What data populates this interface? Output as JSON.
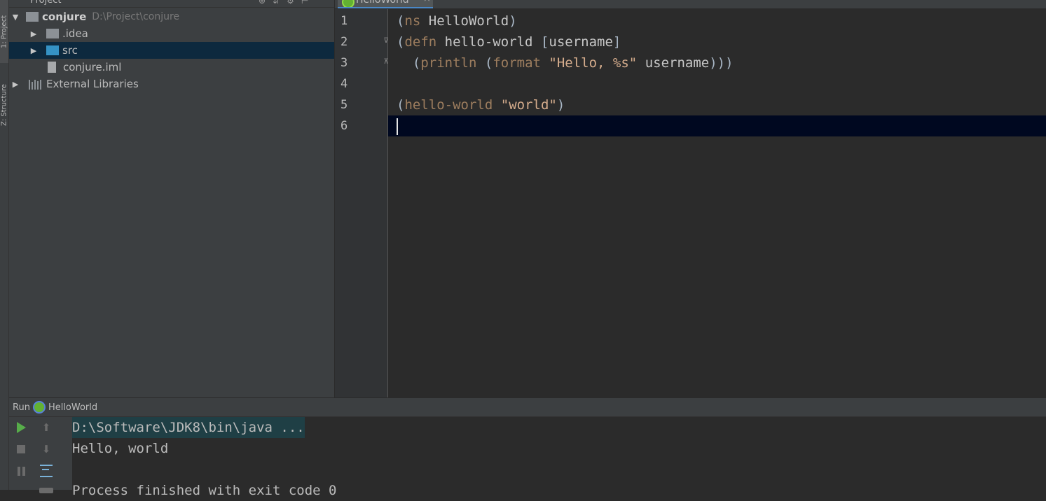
{
  "tool_strip": {
    "project_tab": "1: Project",
    "structure_tab": "Z: Structure"
  },
  "project_panel": {
    "title": "Project",
    "tree": [
      {
        "label": "conjure",
        "path": "D:\\Project\\conjure",
        "icon": "module-folder-icon",
        "expanded": true
      },
      {
        "label": ".idea",
        "icon": "folder-icon"
      },
      {
        "label": "src",
        "icon": "source-folder-icon",
        "selected": true
      },
      {
        "label": "conjure.iml",
        "icon": "file-icon"
      },
      {
        "label": "External Libraries",
        "icon": "library-icon"
      }
    ]
  },
  "editor": {
    "tab_label": "HelloWorld",
    "line_numbers": [
      "1",
      "2",
      "3",
      "4",
      "5",
      "6"
    ],
    "current_line": 6
  },
  "run_panel": {
    "label": "Run",
    "config_name": "HelloWorld",
    "console": {
      "command": "D:\\Software\\JDK8\\bin\\java ...",
      "output": "Hello, world",
      "exit_message": "Process finished with exit code 0"
    }
  },
  "colors": {
    "background": "#2b2b2b",
    "panel": "#3c3f41",
    "selection": "#0d293e",
    "current_line": "#000820",
    "keyword": "#b18c68",
    "string": "#d6ad8d",
    "run_green": "#57ad4a"
  }
}
